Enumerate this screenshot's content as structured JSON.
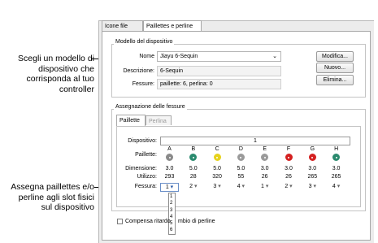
{
  "callouts": {
    "top": [
      "Scegli un modello di",
      "dispositivo che",
      "corrisponda al tuo",
      "controller"
    ],
    "bottom": [
      "Assegna paillettes e/o",
      "perline agli slot fisici",
      "sul dispositivo"
    ]
  },
  "tabs": [
    "Icone file DST",
    "Paillettes e perline"
  ],
  "device_model": {
    "group_title": "Modello del dispositivo",
    "name_label": "Nome",
    "name_value": "Jiayu 6-Sequin",
    "description_label": "Descrizione:",
    "description_value": "6-Sequin",
    "slots_label": "Fessure:",
    "slots_value": "paillette: 6, perlina: 0",
    "buttons": [
      "Modifica...",
      "Nuovo...",
      "Elimina..."
    ]
  },
  "assignment": {
    "group_title": "Assegnazione delle fessure",
    "tabs": [
      "Paillette",
      "Perlina"
    ],
    "device_label": "Dispositivo:",
    "device_value": "1",
    "row_labels": {
      "sequins": "Paillette:",
      "size": "Dimensione:",
      "used": "Utilizzo:",
      "slot": "Fessura:"
    },
    "columns": [
      {
        "letter": "A",
        "color": "#8a8a8a",
        "size": "3.0",
        "used": "293",
        "slot": "1"
      },
      {
        "letter": "B",
        "color": "#2a8a6e",
        "size": "5.0",
        "used": "28",
        "slot": "2"
      },
      {
        "letter": "C",
        "color": "#e6d21c",
        "size": "5.0",
        "used": "320",
        "slot": "3"
      },
      {
        "letter": "D",
        "color": "#9a9a9a",
        "size": "5.0",
        "used": "55",
        "slot": "4"
      },
      {
        "letter": "E",
        "color": "#9a9a9a",
        "size": "3.0",
        "used": "26",
        "slot": "1"
      },
      {
        "letter": "F",
        "color": "#d42020",
        "size": "3.0",
        "used": "26",
        "slot": "2"
      },
      {
        "letter": "G",
        "color": "#d42020",
        "size": "3.0",
        "used": "265",
        "slot": "3"
      },
      {
        "letter": "H",
        "color": "#2a8a6e",
        "size": "3.0",
        "used": "265",
        "slot": "4"
      }
    ],
    "dropdown_options": [
      "1",
      "2",
      "3",
      "4",
      "5",
      "6"
    ]
  },
  "footer": {
    "checkbox_label_left": "Compensa ritardo",
    "checkbox_label_right": "mbio di perline"
  }
}
